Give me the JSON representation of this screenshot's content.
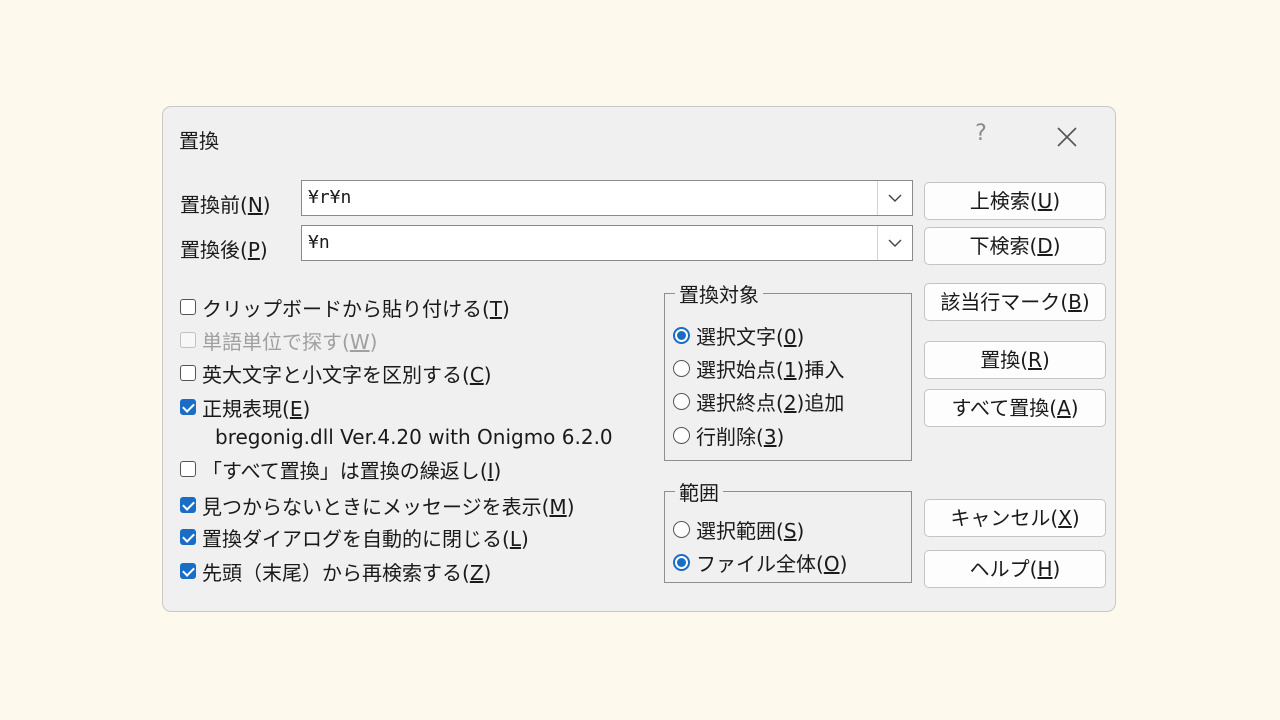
{
  "dialog": {
    "title": "置換",
    "help_glyph": "?"
  },
  "search": {
    "label": "置換前",
    "key": "N",
    "value": "¥r¥n"
  },
  "replace": {
    "label": "置換後",
    "key": "P",
    "value": "¥n"
  },
  "buttons": {
    "search_up": {
      "label": "上検索",
      "key": "U"
    },
    "search_down": {
      "label": "下検索",
      "key": "D"
    },
    "mark_lines": {
      "label": "該当行マーク",
      "key": "B"
    },
    "replace": {
      "label": "置換",
      "key": "R"
    },
    "replace_all": {
      "label": "すべて置換",
      "key": "A"
    },
    "cancel": {
      "label": "キャンセル",
      "key": "X"
    },
    "help": {
      "label": "ヘルプ",
      "key": "H"
    }
  },
  "options": [
    {
      "label": "クリップボードから貼り付ける",
      "key": "T",
      "checked": false,
      "disabled": false
    },
    {
      "label": "単語単位で探す",
      "key": "W",
      "checked": false,
      "disabled": true
    },
    {
      "label": "英大文字と小文字を区別する",
      "key": "C",
      "checked": false,
      "disabled": false
    },
    {
      "label": "正規表現",
      "key": "E",
      "checked": true,
      "disabled": false
    },
    {
      "label": "「すべて置換」は置換の繰返し",
      "key": "I",
      "checked": false,
      "disabled": false
    },
    {
      "label": "見つからないときにメッセージを表示",
      "key": "M",
      "checked": true,
      "disabled": false
    },
    {
      "label": "置換ダイアログを自動的に閉じる",
      "key": "L",
      "checked": true,
      "disabled": false
    },
    {
      "label": "先頭（末尾）から再検索する",
      "key": "Z",
      "checked": true,
      "disabled": false
    }
  ],
  "regex_info": "bregonig.dll Ver.4.20 with Onigmo 6.2.0",
  "target_group": {
    "title": "置換対象",
    "options": [
      {
        "pre": "選択文字",
        "key": "0",
        "post": "",
        "selected": true
      },
      {
        "pre": "選択始点",
        "key": "1",
        "post": "挿入",
        "selected": false
      },
      {
        "pre": "選択終点",
        "key": "2",
        "post": "追加",
        "selected": false
      },
      {
        "pre": "行削除",
        "key": "3",
        "post": "",
        "selected": false
      }
    ]
  },
  "range_group": {
    "title": "範囲",
    "options": [
      {
        "pre": "選択範囲",
        "key": "S",
        "post": "",
        "selected": false
      },
      {
        "pre": "ファイル全体",
        "key": "O",
        "post": "",
        "selected": true
      }
    ]
  },
  "colors": {
    "accent": "#1a6dc5",
    "background": "#fdf9ec",
    "dialog": "#f0f0f0"
  }
}
